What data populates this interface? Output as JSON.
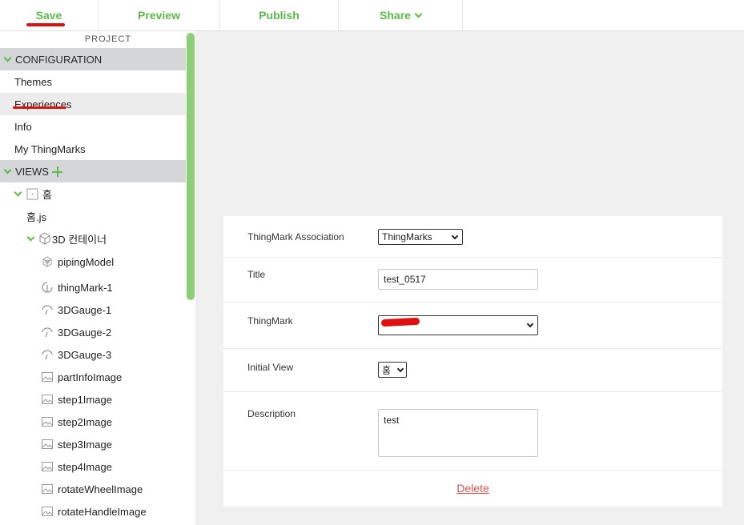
{
  "toolbar": {
    "save": "Save",
    "preview": "Preview",
    "publish": "Publish",
    "share": "Share"
  },
  "sidebar": {
    "project_label": "PROJECT",
    "configuration": {
      "title": "CONFIGURATION",
      "items": [
        "Themes",
        "Experiences",
        "Info",
        "My ThingMarks"
      ]
    },
    "views": {
      "title": "VIEWS",
      "tree": [
        {
          "label": "홈",
          "icon": "page-icon"
        },
        {
          "label": "홈.js",
          "icon": ""
        },
        {
          "label": "3D 컨테이너",
          "icon": "cube-icon"
        },
        {
          "label": "pipingModel",
          "icon": "model-icon"
        },
        {
          "label": "thingMark-1",
          "icon": "thingmark-icon"
        },
        {
          "label": "3DGauge-1",
          "icon": "gauge-icon"
        },
        {
          "label": "3DGauge-2",
          "icon": "gauge-icon"
        },
        {
          "label": "3DGauge-3",
          "icon": "gauge-icon"
        },
        {
          "label": "partInfoImage",
          "icon": "image-icon"
        },
        {
          "label": "step1Image",
          "icon": "image-icon"
        },
        {
          "label": "step2Image",
          "icon": "image-icon"
        },
        {
          "label": "step3Image",
          "icon": "image-icon"
        },
        {
          "label": "step4Image",
          "icon": "image-icon"
        },
        {
          "label": "rotateWheelImage",
          "icon": "image-icon"
        },
        {
          "label": "rotateHandleImage",
          "icon": "image-icon"
        }
      ]
    }
  },
  "form": {
    "thingmark_association": {
      "label": "ThingMark Association",
      "value": "ThingMarks"
    },
    "title": {
      "label": "Title",
      "value": "test_0517"
    },
    "thingmark": {
      "label": "ThingMark",
      "value": ""
    },
    "initial_view": {
      "label": "Initial View",
      "value": "홈"
    },
    "description": {
      "label": "Description",
      "value": "test"
    },
    "delete": "Delete"
  },
  "colors": {
    "accent_green": "#5fb84a",
    "annotation_red": "#e01010",
    "delete_red": "#d9534f"
  }
}
